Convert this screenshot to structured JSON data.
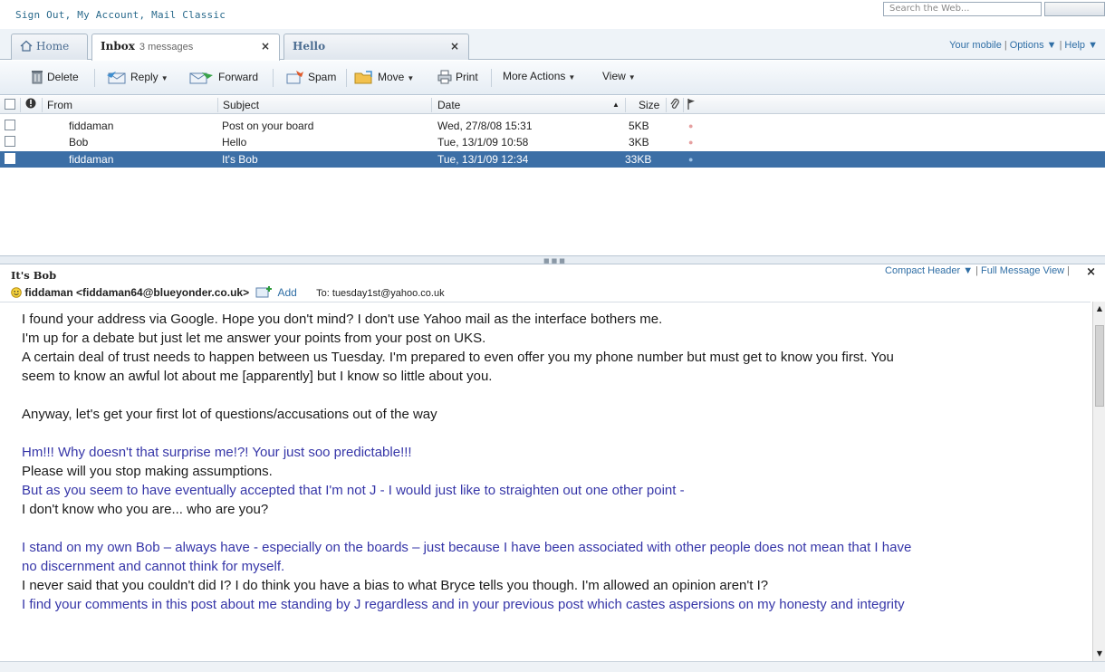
{
  "top": {
    "links": [
      "Sign Out",
      "My Account",
      "Mail Classic"
    ],
    "search_placeholder": "Search the Web..."
  },
  "tabs": {
    "home_label": "Home",
    "inbox_label": "Inbox",
    "inbox_count": "3 messages",
    "hello_label": "Hello",
    "close_glyph": "×",
    "right_links": [
      "Your mobile",
      "Options",
      "Help"
    ]
  },
  "toolbar": {
    "delete": "Delete",
    "reply": "Reply",
    "forward": "Forward",
    "spam": "Spam",
    "move": "Move",
    "print": "Print",
    "more_actions": "More Actions",
    "view": "View"
  },
  "list": {
    "headers": {
      "from": "From",
      "subject": "Subject",
      "date": "Date",
      "size": "Size",
      "sort_glyph": "▲"
    },
    "messages": [
      {
        "from": "fiddaman",
        "subject": "Post on your board",
        "date": "Wed, 27/8/08 15:31",
        "size": "5KB",
        "selected": false
      },
      {
        "from": "Bob",
        "subject": "Hello",
        "date": "Tue, 13/1/09 10:58",
        "size": "3KB",
        "selected": false
      },
      {
        "from": "fiddaman",
        "subject": "It's Bob",
        "date": "Tue, 13/1/09 12:34",
        "size": "33KB",
        "selected": true
      }
    ]
  },
  "preview": {
    "subject": "It's Bob",
    "from": "fiddaman <fiddaman64@blueyonder.co.uk>",
    "add": "Add",
    "to": "To:  tuesday1st@yahoo.co.uk",
    "links": [
      "Compact Header",
      "Full Message View"
    ],
    "lines": [
      {
        "text": "I found your address via Google. Hope you don't mind? I don't use Yahoo mail as the interface bothers me.",
        "style": "black"
      },
      {
        "text": "I'm up for a debate but just let me answer your points from your post on UKS.",
        "style": "black"
      },
      {
        "text": "A certain deal of trust needs to happen between us Tuesday. I'm prepared to even offer you my phone number but must get to know you first. You",
        "style": "black"
      },
      {
        "text": "seem to know an awful lot about me [apparently] but I know so little about you.",
        "style": "black"
      },
      {
        "text": "",
        "style": "gap"
      },
      {
        "text": "Anyway, let's get your first lot of questions/accusations out of the way",
        "style": "black"
      },
      {
        "text": "",
        "style": "gap"
      },
      {
        "text": "Hm!!!  Why doesn't that surprise me!?!  Your just soo predictable!!!",
        "style": "blue"
      },
      {
        "text": "Please will you stop making assumptions.",
        "style": "black"
      },
      {
        "text": "But as you seem to have eventually accepted that I'm not J - I would just like to straighten out one other point -",
        "style": "blue"
      },
      {
        "text": "I don't know who you are... who are you?",
        "style": "black"
      },
      {
        "text": "",
        "style": "gap"
      },
      {
        "text": "I stand on my own Bob – always have - especially on the boards – just because I have been associated with other people does not mean that I have",
        "style": "blue"
      },
      {
        "text": "no discernment and cannot think for myself.",
        "style": "blue"
      },
      {
        "text": "I never said that you couldn't did I? I do think you have a bias to what Bryce tells you though. I'm allowed an opinion aren't I?",
        "style": "black"
      },
      {
        "text": "I find your comments in this post about me standing by J regardless and in your previous post which castes aspersions on my honesty and integrity",
        "style": "blue"
      }
    ]
  },
  "colors": {
    "link": "#2f6ea5",
    "selected_row": "#3c6fa6",
    "quote_blue": "#3636a8"
  }
}
